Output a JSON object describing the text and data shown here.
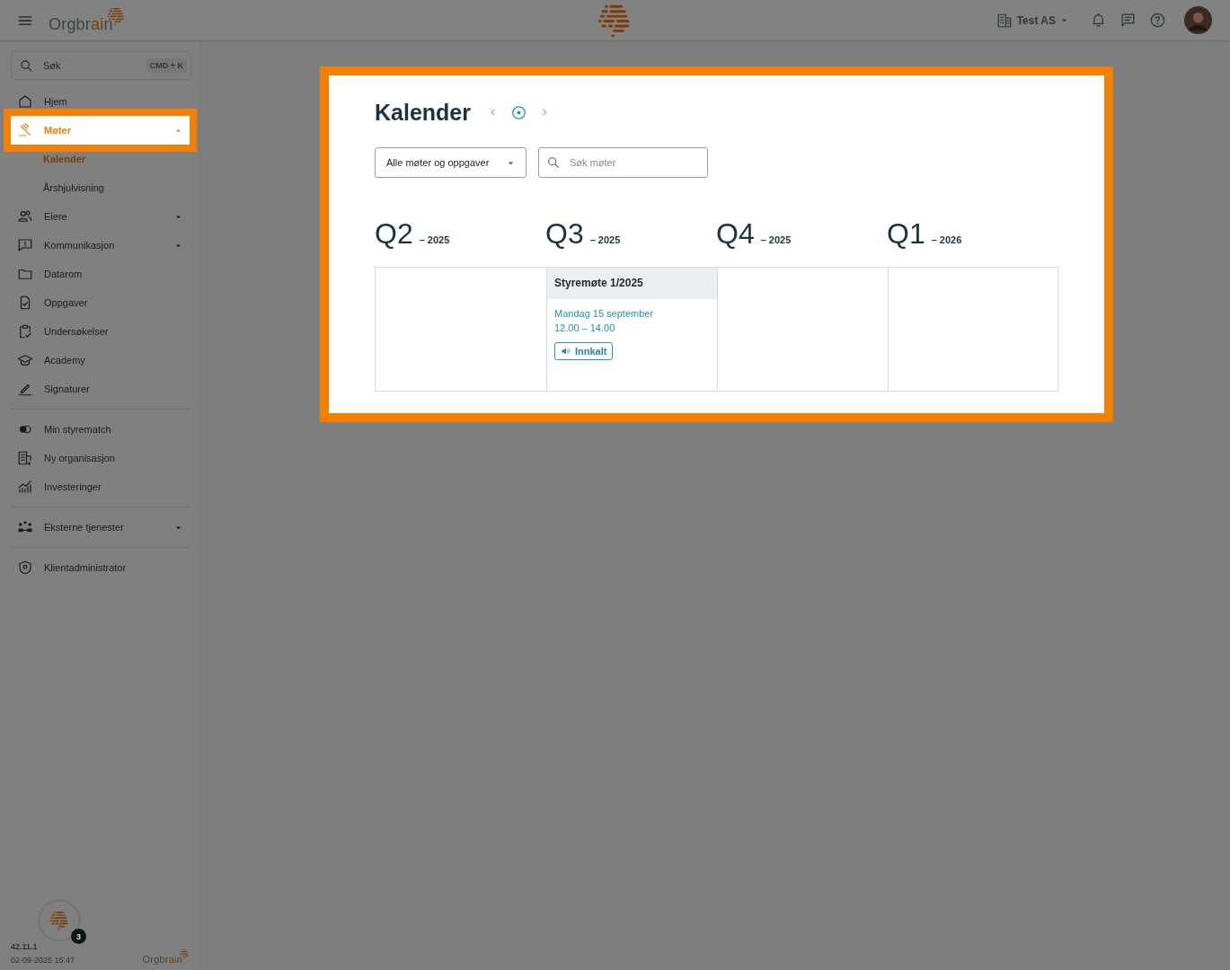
{
  "topbar": {
    "logo": [
      {
        "text": "Orgbr",
        "accent": false
      },
      {
        "text": "ai",
        "accent": true
      },
      {
        "text": "n",
        "accent": false
      }
    ],
    "organization": "Test AS"
  },
  "sidebar": {
    "search": {
      "placeholder": "Søk",
      "shortcut": "CMD + K"
    },
    "groups": [
      [
        {
          "label": "Hjem",
          "kind": "home",
          "selected": false,
          "highlighted": false
        },
        {
          "label": "Møter",
          "kind": "gavel",
          "selected": true,
          "highlighted": true,
          "expanded": true,
          "children": [
            {
              "label": "Kalender",
              "selected": true
            },
            {
              "label": "Årshjulvisning",
              "selected": false
            }
          ]
        },
        {
          "label": "Eiere",
          "kind": "people",
          "selected": false,
          "highlighted": false,
          "expanded": false
        },
        {
          "label": "Kommunikasjon",
          "kind": "message",
          "selected": false,
          "highlighted": false,
          "expanded": false
        },
        {
          "label": "Datarom",
          "kind": "folder",
          "selected": false,
          "highlighted": false
        },
        {
          "label": "Oppgaver",
          "kind": "task",
          "selected": false,
          "highlighted": false
        },
        {
          "label": "Undersøkelser",
          "kind": "survey",
          "selected": false,
          "highlighted": false
        },
        {
          "label": "Academy",
          "kind": "cap",
          "selected": false,
          "highlighted": false
        },
        {
          "label": "Signaturer",
          "kind": "pen",
          "selected": false,
          "highlighted": false
        }
      ],
      [
        {
          "label": "Min styrematch",
          "kind": "toggle",
          "selected": false,
          "highlighted": false
        },
        {
          "label": "Ny organisasjon",
          "kind": "building",
          "selected": false,
          "highlighted": false
        },
        {
          "label": "Investeringer",
          "kind": "chart",
          "selected": false,
          "highlighted": false
        }
      ],
      [
        {
          "label": "Eksterne tjenester",
          "kind": "nodes",
          "selected": false,
          "highlighted": false,
          "expanded": false
        }
      ],
      [
        {
          "label": "Klientadministrator",
          "kind": "shield",
          "selected": false,
          "highlighted": false
        }
      ]
    ],
    "help_badge": "3",
    "version": "42.11.1",
    "build_date": "02-09-2025 15:47",
    "footer_logo": [
      {
        "text": "Orgbr",
        "accent": false
      },
      {
        "text": "ai",
        "accent": true
      },
      {
        "text": "n",
        "accent": false
      }
    ]
  },
  "calendar": {
    "highlighted": true,
    "title": "Kalender",
    "filter": "Alle møter og oppgaver",
    "search": {
      "placeholder": "Søk møter"
    },
    "quarters": [
      {
        "quarter": "Q2",
        "year": "– 2025"
      },
      {
        "quarter": "Q3",
        "year": "– 2025",
        "events": [
          {
            "title": "Styremøte 1/2025",
            "date": "Mandag 15 september",
            "time": "12.00 – 14.00",
            "status": "Innkalt"
          }
        ]
      },
      {
        "quarter": "Q4",
        "year": "– 2025"
      },
      {
        "quarter": "Q1",
        "year": "– 2026"
      }
    ]
  }
}
